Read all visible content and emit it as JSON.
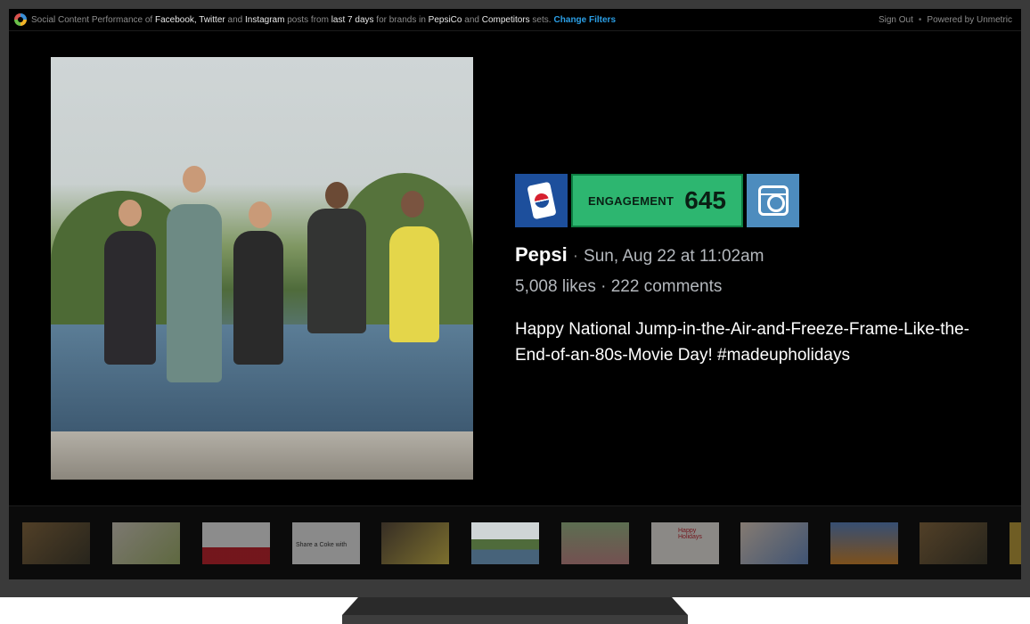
{
  "topbar": {
    "p1": "Social Content Performance of",
    "net1": "Facebook,",
    "net2": "Twitter",
    "and1": "and",
    "net3": "Instagram",
    "p2": "posts from",
    "range": "last 7 days",
    "p3": "for brands in",
    "set1": "PepsiCo",
    "and2": "and",
    "set2": "Competitors",
    "p4": "sets.",
    "change_filters": "Change Filters",
    "sign_out": "Sign Out",
    "dot": "•",
    "powered_by": "Powered by Unmetric"
  },
  "post": {
    "brand": "Pepsi",
    "sep": "·",
    "date": "Sun, Aug 22 at 11:02am",
    "likes": "5,008 likes",
    "stats_sep": "·",
    "comments": "222 comments",
    "caption": "Happy National Jump-in-the-Air-and-Freeze-Frame-Like-the-End-of-an-80s-Movie Day! #madeupholidays",
    "engagement_label": "ENGAGEMENT",
    "engagement_value": "645",
    "network_icon": "instagram-icon",
    "brand_icon": "pepsi-can-icon"
  },
  "thumbnails": [
    {
      "name": "thumb-1",
      "caption": ""
    },
    {
      "name": "thumb-2",
      "caption": ""
    },
    {
      "name": "thumb-3",
      "caption": ""
    },
    {
      "name": "thumb-4",
      "caption": "Share a Coke with"
    },
    {
      "name": "thumb-5",
      "caption": ""
    },
    {
      "name": "thumb-6",
      "caption": ""
    },
    {
      "name": "thumb-7",
      "caption": ""
    },
    {
      "name": "thumb-8",
      "caption": "Happy Holidays"
    },
    {
      "name": "thumb-9",
      "caption": ""
    },
    {
      "name": "thumb-10",
      "caption": ""
    },
    {
      "name": "thumb-11",
      "caption": ""
    }
  ],
  "colors": {
    "engagement_green": "#2db670",
    "link_blue": "#2b9fe6",
    "pepsi_blue": "#1d4f9c",
    "instagram_blue": "#4d8cbe"
  }
}
